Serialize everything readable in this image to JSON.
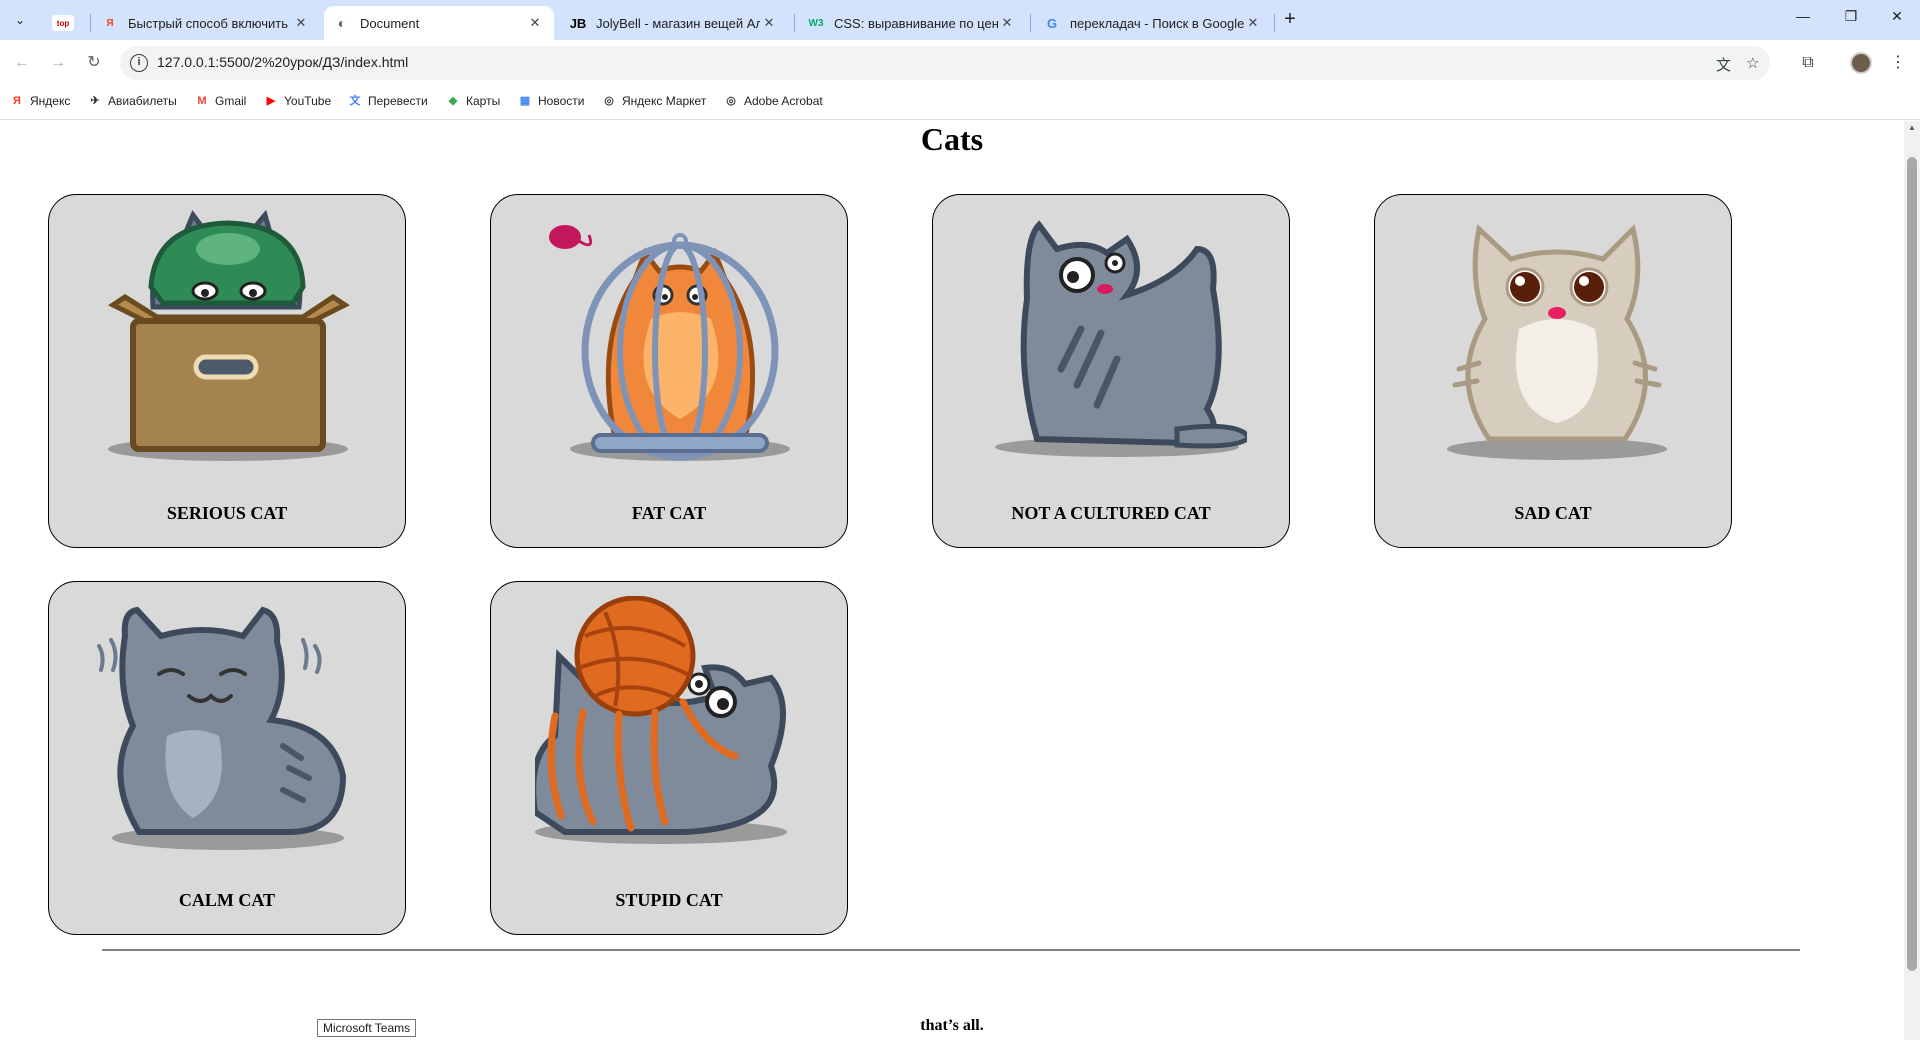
{
  "browser": {
    "tabs": [
      {
        "label": "Быстрый способ включить ра",
        "favicon": "Я",
        "favicon_color": "#fc3f1d"
      },
      {
        "label": "Document",
        "favicon": "◐",
        "favicon_color": "#5f6368"
      },
      {
        "label": "JolyBell - магазин вещей Алек",
        "favicon": "JB",
        "favicon_color": "#000000"
      },
      {
        "label": "CSS: выравнивание по центру",
        "favicon": "W3",
        "favicon_color": "#04aa6d"
      },
      {
        "label": "перекладач - Поиск в Google",
        "favicon": "G",
        "favicon_color": "#4285f4"
      }
    ],
    "first_tab_badge": "top",
    "url": "127.0.0.1:5500/2%20урок/ДЗ/index.html",
    "bookmarks": [
      {
        "label": "Яндекс",
        "icon": "Я",
        "color": "#fc3f1d"
      },
      {
        "label": "Авиабилеты",
        "icon": "✈",
        "color": "#333333"
      },
      {
        "label": "Gmail",
        "icon": "M",
        "color": "#ea4335"
      },
      {
        "label": "YouTube",
        "icon": "▶",
        "color": "#ff0000"
      },
      {
        "label": "Перевести",
        "icon": "文",
        "color": "#4285f4"
      },
      {
        "label": "Карты",
        "icon": "◆",
        "color": "#34a853"
      },
      {
        "label": "Новости",
        "icon": "▦",
        "color": "#4285f4"
      },
      {
        "label": "Яндекс Маркет",
        "icon": "◎",
        "color": "#444444"
      },
      {
        "label": "Adobe Acrobat",
        "icon": "◎",
        "color": "#444444"
      }
    ]
  },
  "page": {
    "title": "Cats",
    "cards": [
      {
        "caption": "SERIOUS CAT"
      },
      {
        "caption": "FAT CAT"
      },
      {
        "caption": "NOT A CULTURED CAT"
      },
      {
        "caption": "SAD CAT"
      },
      {
        "caption": "CALM CAT"
      },
      {
        "caption": "STUPID CAT"
      }
    ],
    "footer": "that’s all."
  },
  "tooltip": "Microsoft Teams"
}
